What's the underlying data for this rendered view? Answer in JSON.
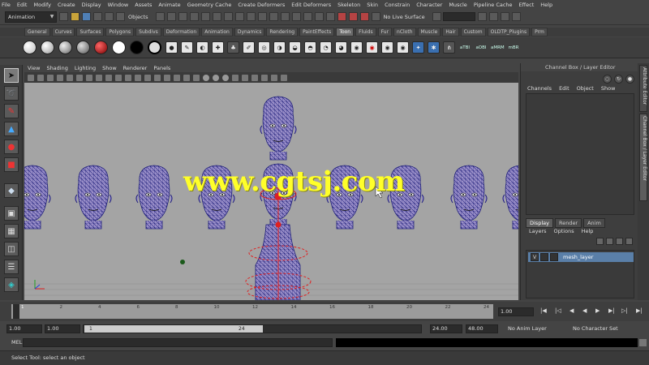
{
  "menubar": [
    "File",
    "Edit",
    "Modify",
    "Create",
    "Display",
    "Window",
    "Assets",
    "Animate",
    "Geometry Cache",
    "Create Deformers",
    "Edit Deformers",
    "Skeleton",
    "Skin",
    "Constrain",
    "Character",
    "Muscle",
    "Pipeline Cache",
    "Effect",
    "Help"
  ],
  "statusline": {
    "mode": "Animation",
    "selection_mode": "Objects",
    "no_live": "No Live Surface"
  },
  "shelf_tabs": [
    "General",
    "Curves",
    "Surfaces",
    "Polygons",
    "Subdivs",
    "Deformation",
    "Animation",
    "Dynamics",
    "Rendering",
    "PaintEffects",
    "Toon",
    "Fluids",
    "Fur",
    "nCloth",
    "Muscle",
    "Hair",
    "Custom",
    "OLDTP_Plugins",
    "Prm"
  ],
  "shelf_tabs_active": "Toon",
  "shelf_labels": [
    "aTBI",
    "aOBI",
    "aMRM",
    "mBR"
  ],
  "panel_menu": [
    "View",
    "Shading",
    "Lighting",
    "Show",
    "Renderer",
    "Panels"
  ],
  "watermark": "www.cgtsj.com",
  "channel_box": {
    "title": "Channel Box / Layer Editor",
    "menu": [
      "Channels",
      "Edit",
      "Object",
      "Show"
    ],
    "layer_tabs": [
      "Display",
      "Render",
      "Anim"
    ],
    "layer_tabs_active": "Display",
    "layer_menu": [
      "Layers",
      "Options",
      "Help"
    ],
    "layer_name": "mesh_layer",
    "layer_visible": "V"
  },
  "side_tabs": [
    "Attribute Editor",
    "Channel Box / Layer Editor"
  ],
  "time_slider": {
    "ticks": [
      "2",
      "4",
      "6",
      "8",
      "10",
      "12",
      "14",
      "16",
      "18",
      "20",
      "22",
      "24"
    ],
    "first_frame": "1",
    "current_frame": "1.00"
  },
  "range_slider": {
    "start": "1.00",
    "playback_start": "1.00",
    "thumb_start": "1",
    "thumb_end": "24",
    "playback_end": "24.00",
    "end": "48.00",
    "anim_layer": "No Anim Layer",
    "character_set": "No Character Set"
  },
  "command_line": {
    "label": "MEL"
  },
  "help_line": "Select Tool: select an object",
  "colors": {
    "wireframe": "#1f1f7a",
    "skin": "#9a8fc9",
    "selection": "#e02020",
    "watermark": "#ffff2a",
    "layer_highlight": "#5a7fa8"
  }
}
